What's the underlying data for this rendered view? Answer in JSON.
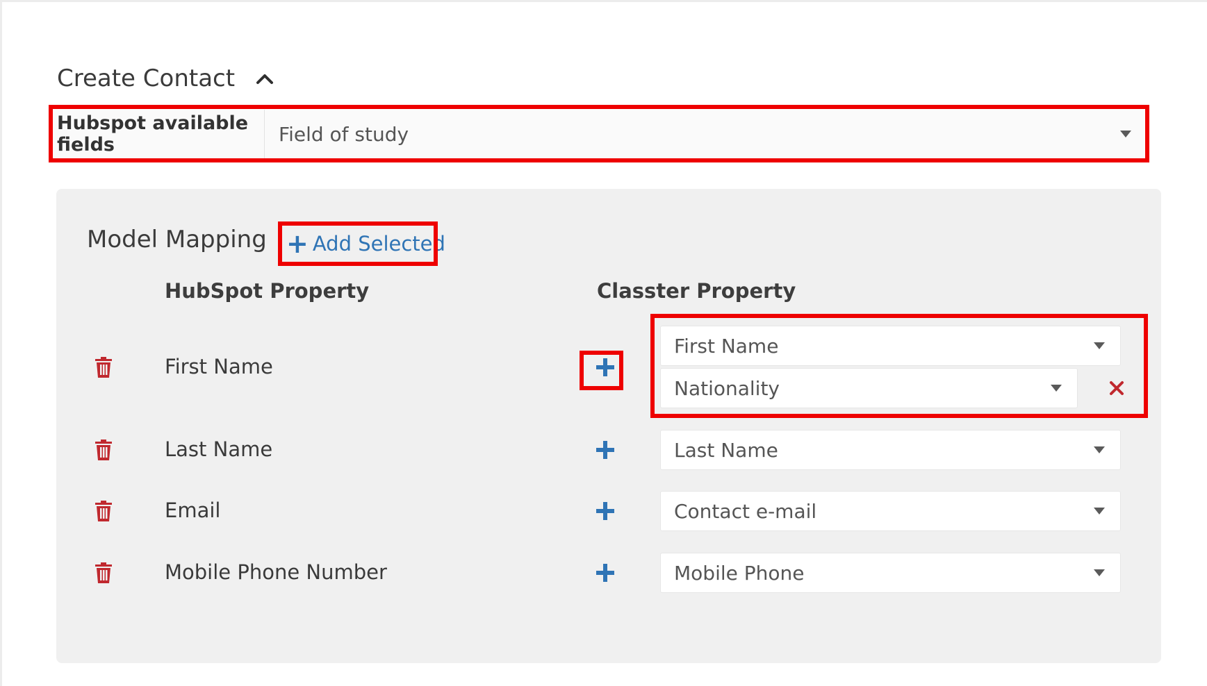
{
  "section": {
    "title": "Create Contact",
    "collapse_icon": "chevron-up-icon"
  },
  "hubspot_fields": {
    "label": "Hubspot available fields",
    "selected": "Field of study"
  },
  "mapping": {
    "title": "Model Mapping",
    "add_selected_label": "Add Selected",
    "columns": {
      "hubspot": "HubSpot Property",
      "classter": "Classter Property"
    },
    "rows": [
      {
        "hubspot": "First Name",
        "classter": [
          "First Name",
          "Nationality"
        ]
      },
      {
        "hubspot": "Last Name",
        "classter": [
          "Last Name"
        ]
      },
      {
        "hubspot": "Email",
        "classter": [
          "Contact e-mail"
        ]
      },
      {
        "hubspot": "Mobile Phone Number",
        "classter": [
          "Mobile Phone"
        ]
      }
    ]
  },
  "colors": {
    "accent": "#2f74b5",
    "danger": "#c0282e",
    "highlight": "#ee0000",
    "panel": "#f0f0f0"
  }
}
